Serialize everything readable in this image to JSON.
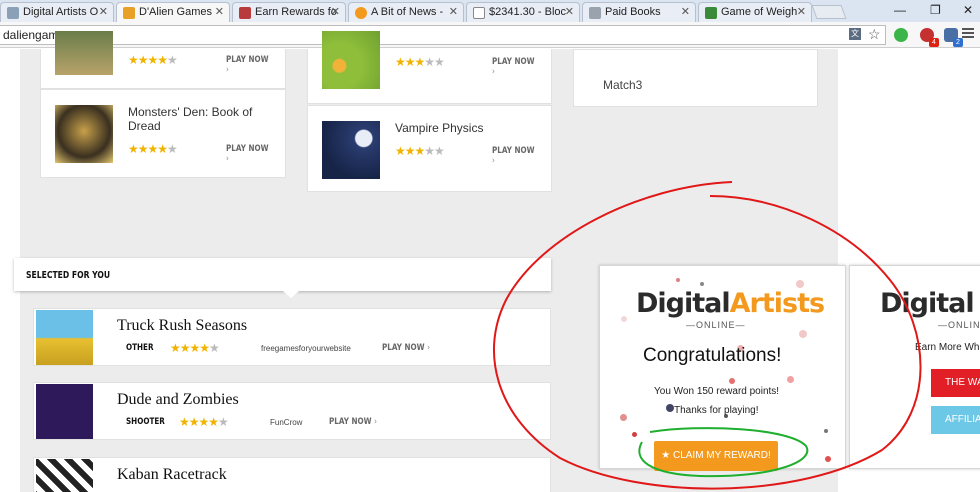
{
  "browser": {
    "tabs": [
      {
        "label": "Digital Artists O",
        "icon_color": "#8aa0b6"
      },
      {
        "label": "D'Alien Games",
        "icon_color": "#e8a126"
      },
      {
        "label": "Earn Rewards fo",
        "icon_color": "#b83a3a"
      },
      {
        "label": "A Bit of News -",
        "icon_color": "#f39a1e"
      },
      {
        "label": "$2341.30 - Bloc",
        "icon_color": "#888888"
      },
      {
        "label": "Paid Books",
        "icon_color": "#9aa3ad"
      },
      {
        "label": "Game of Weigh",
        "icon_color": "#3a8a3a"
      }
    ],
    "address": "daliengames.com",
    "ext_badges": [
      "4",
      "2"
    ]
  },
  "games_top": [
    {
      "name": "",
      "play": "PLAY NOW"
    },
    {
      "name": "",
      "play": "PLAY NOW"
    },
    {
      "name": "Monsters' Den: Book of Dread",
      "play": "PLAY NOW"
    },
    {
      "name": "Vampire Physics",
      "play": "PLAY NOW"
    }
  ],
  "sidebar_item": "Match3",
  "selected": {
    "label": "SELECTED FOR YOU",
    "rows": [
      {
        "title": "Truck Rush Seasons",
        "category": "OTHER",
        "source": "freegamesforyourwebsite",
        "play": "PLAY NOW"
      },
      {
        "title": "Dude and Zombies",
        "category": "SHOOTER",
        "source": "FunCrow",
        "play": "PLAY NOW"
      },
      {
        "title": "Kaban Racetrack",
        "category": "",
        "source": "",
        "play": ""
      }
    ]
  },
  "popup": {
    "logo_text_a": "Digital",
    "logo_text_b": "Artists",
    "logo_sub": "ONLINE",
    "title": "Congratulations!",
    "line1": "You Won 150 reward points!",
    "line2": "Thanks for playing!",
    "button": "CLAIM MY REWARD!",
    "button_icon": "star-icon"
  },
  "popup2": {
    "logo_text_a": "Digital",
    "logo_sub": "ONLINE",
    "text": "Earn More Whi",
    "btn1": "THE WA",
    "btn2": "AFFILIA"
  },
  "colors": {
    "annotation_red": "#e01818",
    "annotation_green": "#1fae2e",
    "orange": "#f39a1e"
  }
}
